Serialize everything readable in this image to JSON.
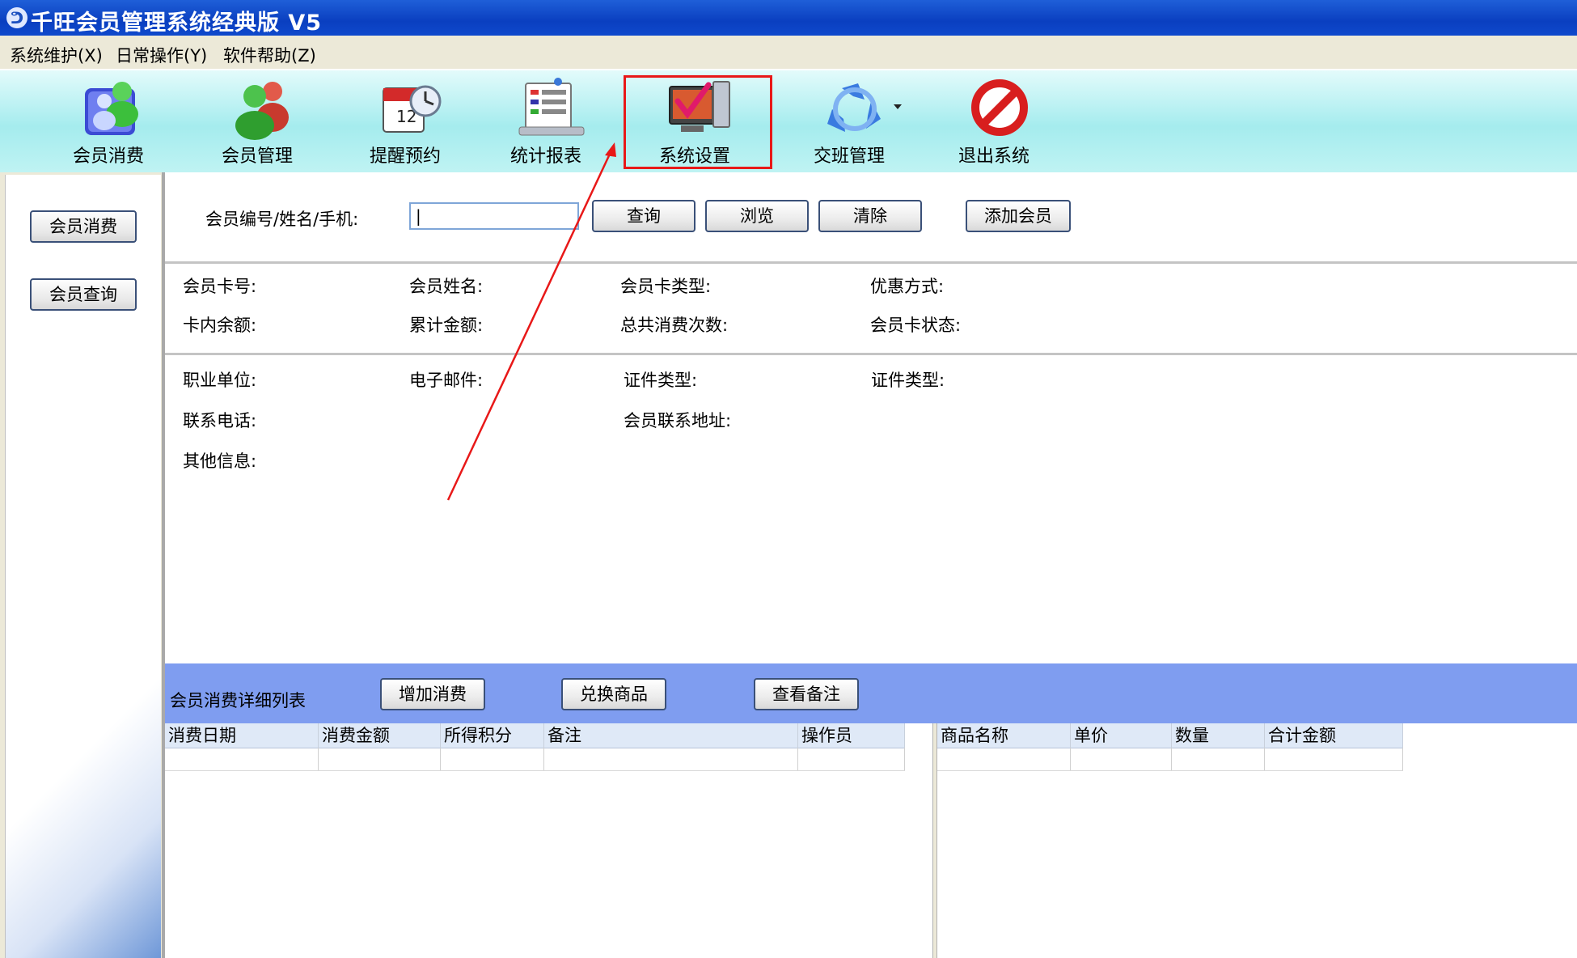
{
  "window": {
    "title": "千旺会员管理系统经典版 V5"
  },
  "menu": [
    "系统维护(X)",
    "日常操作(Y)",
    "软件帮助(Z)"
  ],
  "toolbar": {
    "items": [
      {
        "label": "会员消费",
        "icon": "members-consume-icon"
      },
      {
        "label": "会员管理",
        "icon": "members-manage-icon"
      },
      {
        "label": "提醒预约",
        "icon": "calendar-clock-icon"
      },
      {
        "label": "统计报表",
        "icon": "report-icon"
      },
      {
        "label": "系统设置",
        "icon": "settings-monitor-icon"
      },
      {
        "label": "交班管理",
        "icon": "recycle-icon"
      },
      {
        "label": "退出系统",
        "icon": "exit-prohibited-icon"
      }
    ]
  },
  "sidebar": {
    "buttons": [
      "会员消费",
      "会员查询"
    ]
  },
  "search": {
    "label": "会员编号/姓名/手机:",
    "value": "|",
    "buttons": {
      "query": "查询",
      "browse": "浏览",
      "clear": "清除",
      "add": "添加会员"
    }
  },
  "member_info": {
    "card_no": "会员卡号:",
    "name": "会员姓名:",
    "card_type": "会员卡类型:",
    "discount": "优惠方式:",
    "balance": "卡内余额:",
    "total_amount": "累计金额:",
    "total_count": "总共消费次数:",
    "card_status": "会员卡状态:"
  },
  "extra_info": {
    "company": "职业单位:",
    "email": "电子邮件:",
    "id_type_1": "证件类型:",
    "id_type_2": "证件类型:",
    "phone": "联系电话:",
    "address": "会员联系地址:",
    "other": "其他信息:"
  },
  "detail": {
    "title": "会员消费详细列表",
    "buttons": {
      "add_consume": "增加消费",
      "exchange": "兑换商品",
      "view_note": "查看备注"
    }
  },
  "consume_table": {
    "columns": [
      "消费日期",
      "消费金额",
      "所得积分",
      "备注",
      "操作员"
    ]
  },
  "goods_table": {
    "columns": [
      "商品名称",
      "单价",
      "数量",
      "合计金额"
    ]
  },
  "colors": {
    "annotation": "#e81818",
    "toolbar_bg": "#a5ecee",
    "detail_bar": "#7f9df0"
  }
}
